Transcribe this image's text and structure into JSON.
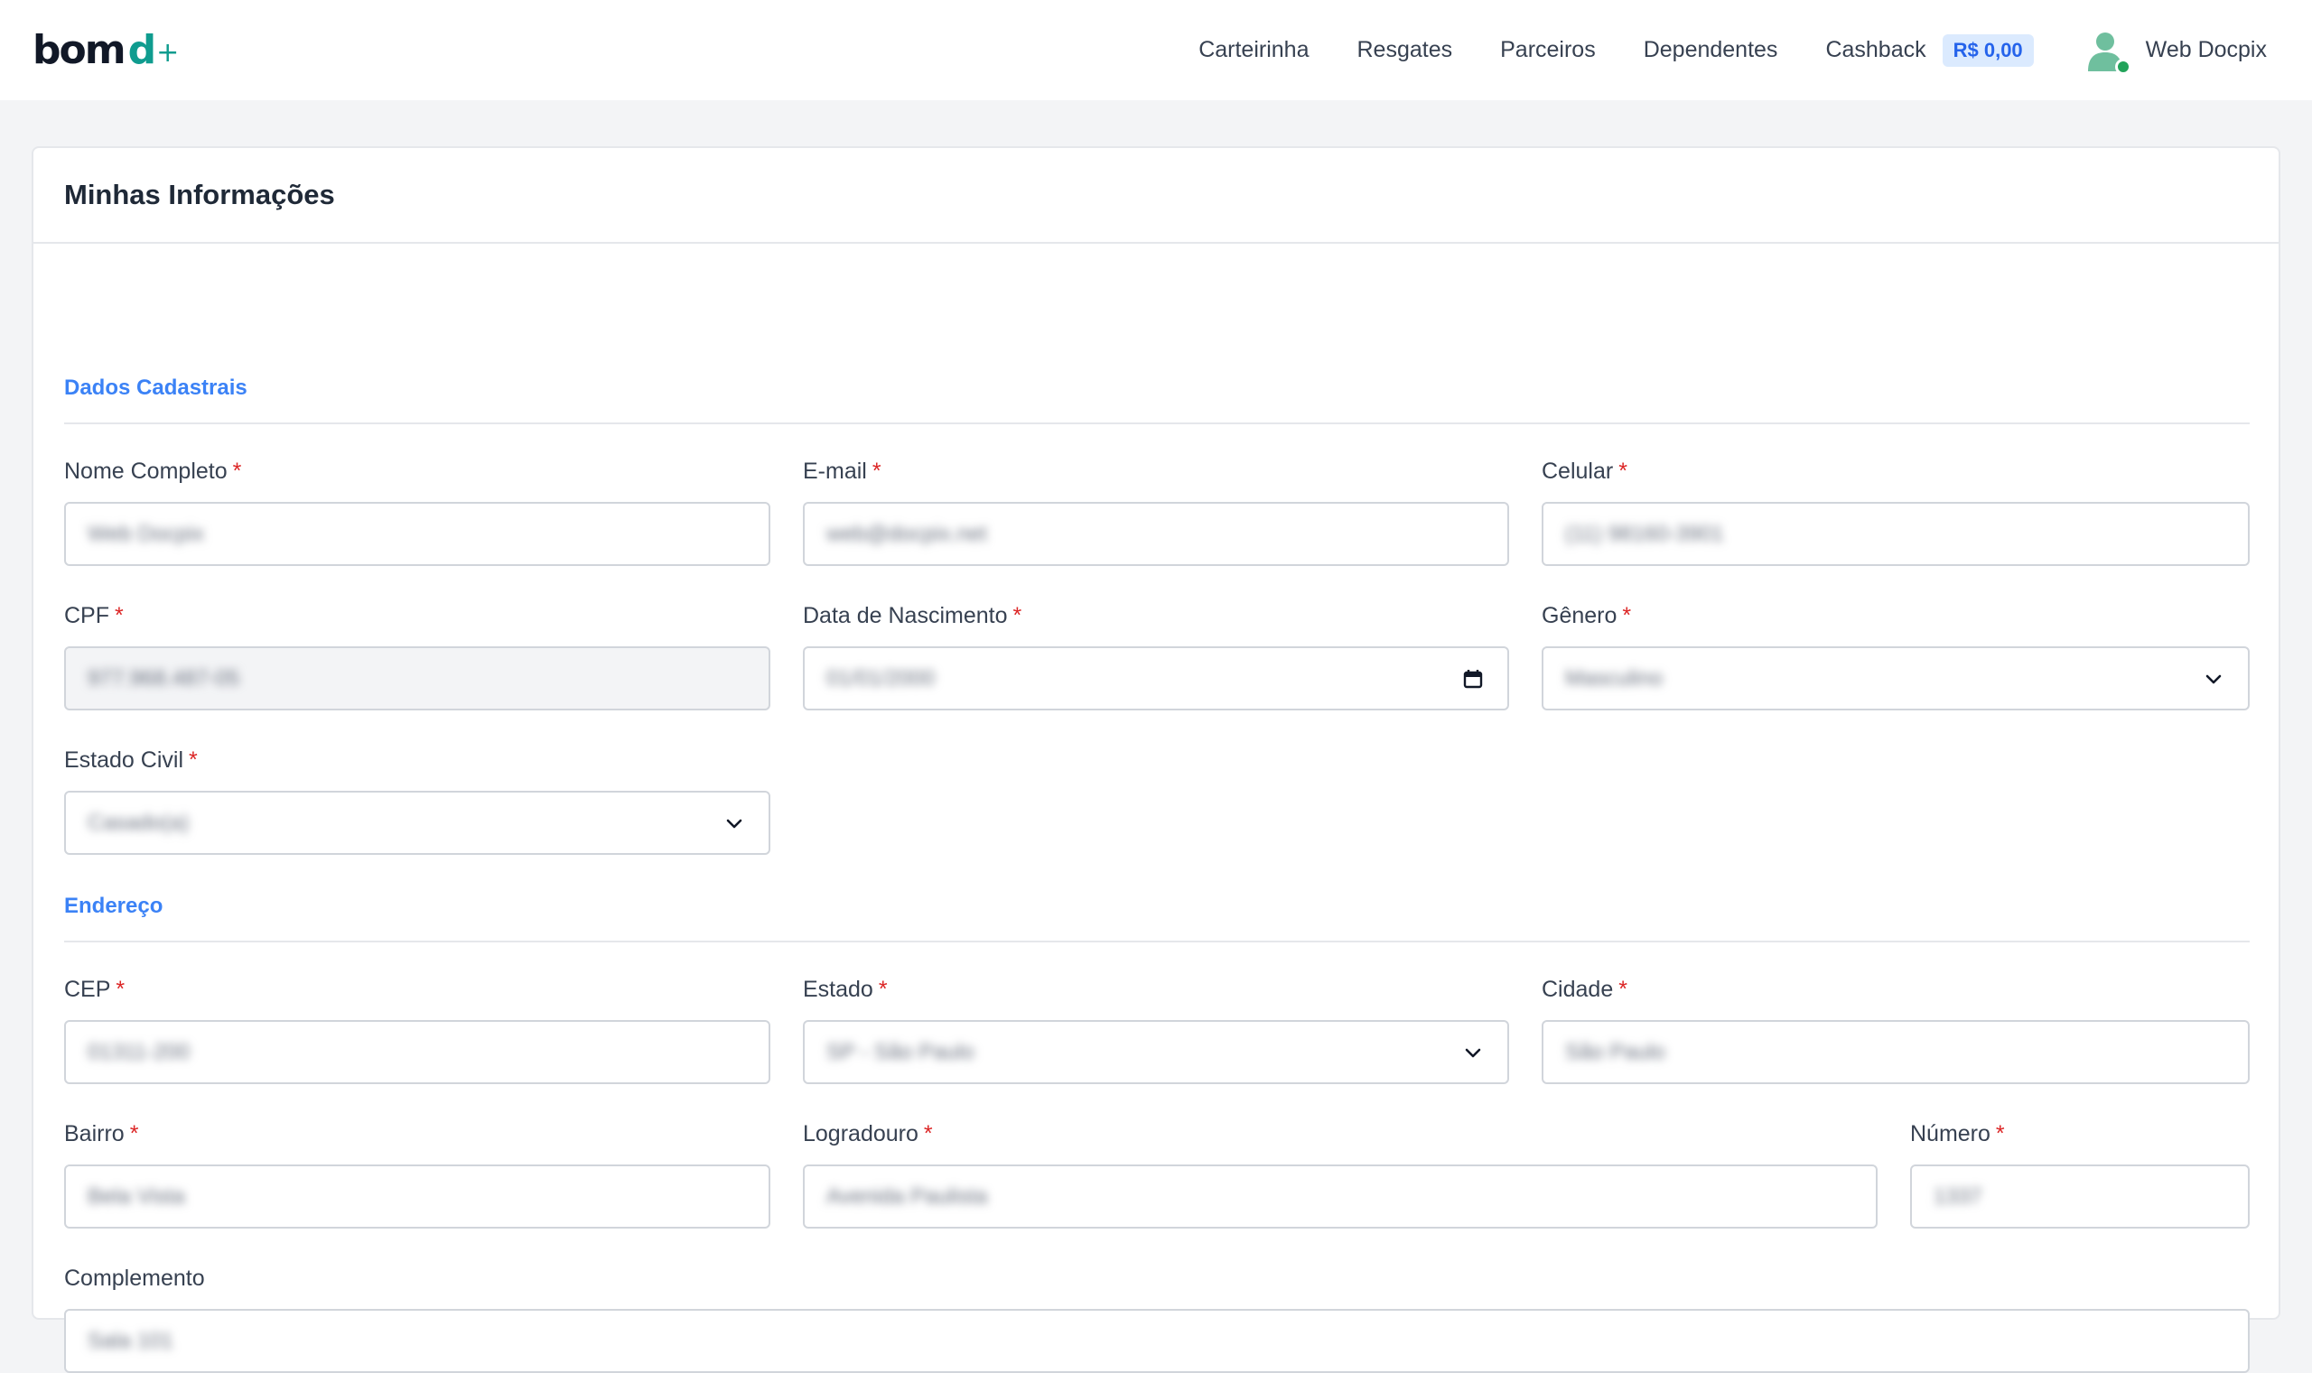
{
  "header": {
    "logo": {
      "main": "bom",
      "accent": "d",
      "plus": "+"
    },
    "nav": [
      {
        "label": "Carteirinha"
      },
      {
        "label": "Resgates"
      },
      {
        "label": "Parceiros"
      },
      {
        "label": "Dependentes"
      },
      {
        "label": "Cashback"
      }
    ],
    "cashback_badge": "R$ 0,00",
    "user": {
      "name": "Web Docpix",
      "status": "online"
    }
  },
  "page": {
    "title": "Minhas Informações"
  },
  "sections": {
    "dados": {
      "title": "Dados Cadastrais",
      "fields": {
        "nome": {
          "label": "Nome Completo",
          "required": "*",
          "value": "Web Docpix"
        },
        "email": {
          "label": "E-mail",
          "required": "*",
          "value": "web@docpix.net"
        },
        "celular": {
          "label": "Celular",
          "required": "*",
          "value": "(11) 98160-3901"
        },
        "cpf": {
          "label": "CPF",
          "required": "*",
          "value": "977.968.487-05"
        },
        "nascimento": {
          "label": "Data de Nascimento",
          "required": "*",
          "value": "01/01/2000"
        },
        "genero": {
          "label": "Gênero",
          "required": "*",
          "value": "Masculino"
        },
        "estado_civil": {
          "label": "Estado Civil",
          "required": "*",
          "value": "Casado(a)"
        }
      }
    },
    "endereco": {
      "title": "Endereço",
      "fields": {
        "cep": {
          "label": "CEP",
          "required": "*",
          "value": "01311-200"
        },
        "estado": {
          "label": "Estado",
          "required": "*",
          "value": "SP - São Paulo"
        },
        "cidade": {
          "label": "Cidade",
          "required": "*",
          "value": "São Paulo"
        },
        "bairro": {
          "label": "Bairro",
          "required": "*",
          "value": "Bela Vista"
        },
        "logradouro": {
          "label": "Logradouro",
          "required": "*",
          "value": "Avenida Paulista"
        },
        "numero": {
          "label": "Número",
          "required": "*",
          "value": "1337"
        },
        "complemento": {
          "label": "Complemento",
          "value": "Sala 101"
        }
      }
    }
  },
  "icons": {
    "calendar": "calendar-icon",
    "chevron": "chevron-down-icon",
    "avatar": "user-avatar-icon"
  },
  "colors": {
    "accent": "#3b82f6",
    "brand": "#0f9c8f",
    "required": "#dc2626",
    "badge_bg": "#dbeafe",
    "online": "#22a35a"
  }
}
